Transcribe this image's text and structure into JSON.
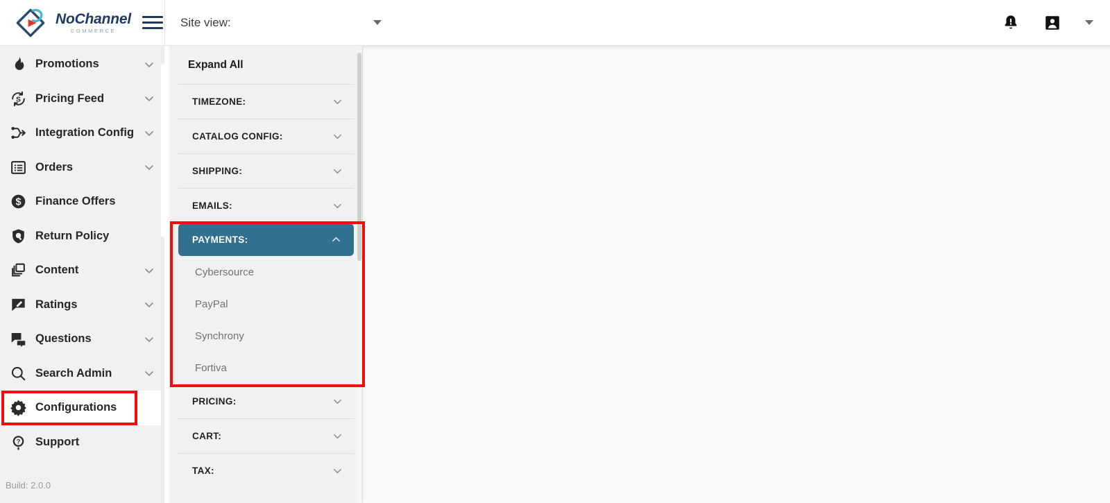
{
  "topbar": {
    "logo": {
      "title_part1": "No",
      "title_part2": "Channel",
      "subtitle": "COMMERCE",
      "icon": "nochannel-logo-icon"
    },
    "menu_toggle_icon": "hamburger-menu-icon",
    "site_view": {
      "label": "Site view:",
      "caret_icon": "caret-down-icon"
    },
    "notifications_icon": "bell-alert-icon",
    "account_icon": "user-account-icon",
    "account_caret_icon": "caret-down-icon"
  },
  "sidebar": {
    "items": [
      {
        "label": "Promotions",
        "icon": "flame-icon",
        "has_chevron": true,
        "active": false
      },
      {
        "label": "Pricing Feed",
        "icon": "price-refresh-icon",
        "has_chevron": true,
        "active": false
      },
      {
        "label": "Integration Config",
        "icon": "integration-icon",
        "has_chevron": true,
        "active": false
      },
      {
        "label": "Orders",
        "icon": "orders-list-icon",
        "has_chevron": true,
        "active": false
      },
      {
        "label": "Finance Offers",
        "icon": "dollar-circle-icon",
        "has_chevron": false,
        "active": false
      },
      {
        "label": "Return Policy",
        "icon": "shield-return-icon",
        "has_chevron": false,
        "active": false
      },
      {
        "label": "Content",
        "icon": "content-pages-icon",
        "has_chevron": true,
        "active": false
      },
      {
        "label": "Ratings",
        "icon": "ratings-icon",
        "has_chevron": true,
        "active": false
      },
      {
        "label": "Questions",
        "icon": "questions-icon",
        "has_chevron": true,
        "active": false
      },
      {
        "label": "Search Admin",
        "icon": "search-icon",
        "has_chevron": true,
        "active": false
      },
      {
        "label": "Configurations",
        "icon": "gear-icon",
        "has_chevron": false,
        "active": true
      },
      {
        "label": "Support",
        "icon": "help-circle-icon",
        "has_chevron": false,
        "active": false
      }
    ],
    "build_label": "Build: 2.0.0"
  },
  "config_panel": {
    "expand_all_label": "Expand All",
    "sections": [
      {
        "label": "TIMEZONE:",
        "expanded": false,
        "items": []
      },
      {
        "label": "CATALOG CONFIG:",
        "expanded": false,
        "items": []
      },
      {
        "label": "SHIPPING:",
        "expanded": false,
        "items": []
      },
      {
        "label": "EMAILS:",
        "expanded": false,
        "items": []
      },
      {
        "label": "PAYMENTS:",
        "expanded": true,
        "items": [
          "Cybersource",
          "PayPal",
          "Synchrony",
          "Fortiva"
        ]
      },
      {
        "label": "PRICING:",
        "expanded": false,
        "items": []
      },
      {
        "label": "CART:",
        "expanded": false,
        "items": []
      },
      {
        "label": "TAX:",
        "expanded": false,
        "items": []
      }
    ]
  },
  "colors": {
    "accent_blue": "#31708f",
    "brand_navy": "#1f3b63",
    "brand_red": "#e8332a",
    "brand_teal": "#49b7c4",
    "highlight_red": "#f20d0d",
    "sidebar_bg": "#f1f1f1"
  }
}
